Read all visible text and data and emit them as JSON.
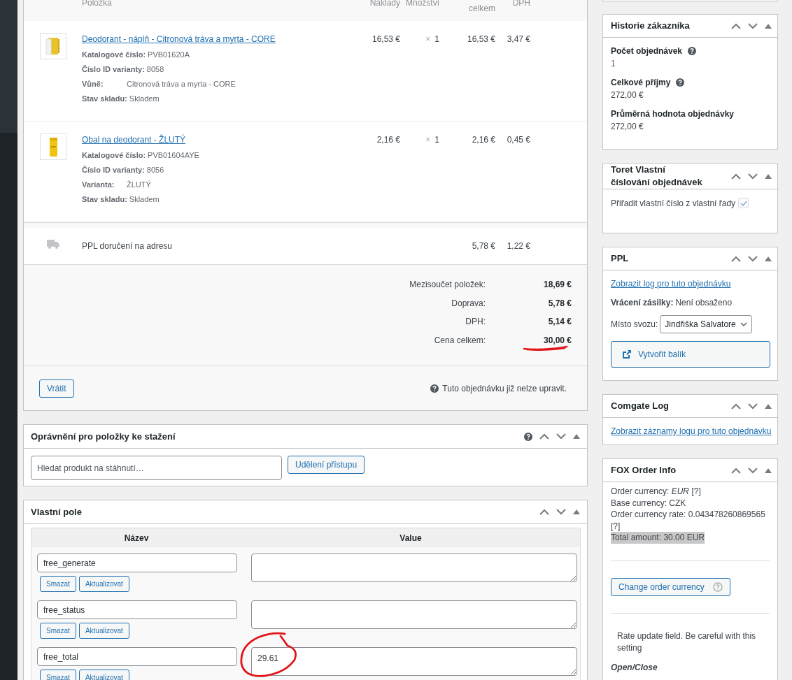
{
  "items_table": {
    "columns": [
      {
        "label": "Položka",
        "kind": "name"
      },
      {
        "label": "Náklady",
        "kind": "num"
      },
      {
        "label": "Množství",
        "kind": "num"
      },
      {
        "label": "celkem",
        "kind": "low"
      },
      {
        "label": "DPH",
        "kind": "num"
      }
    ],
    "items": [
      {
        "name": "Deodorant - náplň - Citronová tráva a myrta - CORE",
        "meta": [
          {
            "kind": "info",
            "label": "Katalogové číslo:",
            "value": "PVB01620A"
          },
          {
            "kind": "info",
            "label": "Číslo ID varianty:",
            "value": "8058"
          },
          {
            "kind": "attribute",
            "label": "Vůně:",
            "value": "Citronová tráva a myrta - CORE"
          },
          {
            "kind": "attribute",
            "label": "Stav skladu:",
            "value": "Skladem"
          }
        ],
        "cost": "16,53 €",
        "quantity_sign": "×",
        "quantity": "1",
        "total": "16,53 €",
        "tax": "3,47 €"
      },
      {
        "name": "Obal na deodorant - ŽLUTÝ",
        "meta": [
          {
            "kind": "info",
            "label": "Katalogové číslo:",
            "value": "PVB01604AYE"
          },
          {
            "kind": "info",
            "label": "Číslo ID varianty:",
            "value": "8056"
          },
          {
            "kind": "attribute",
            "label": "Varianta:",
            "value": "ŽLUTÝ"
          },
          {
            "kind": "attribute",
            "label": "Stav skladu:",
            "value": "Skladem"
          }
        ],
        "cost": "2,16 €",
        "quantity_sign": "×",
        "quantity": "1",
        "total": "2,16 €",
        "tax": "0,45 €"
      }
    ],
    "shipping": {
      "name": "PPL doručení na adresu",
      "total": "5,78 €",
      "tax": "1,22 €"
    },
    "totals": [
      {
        "label": "Mezisoučet položek:",
        "value": "18,69 €"
      },
      {
        "label": "Doprava:",
        "value": "5,78 €"
      },
      {
        "label": "DPH:",
        "value": "5,14 €"
      },
      {
        "label": "Cena celkem:",
        "value": "30,00 €",
        "marked": true
      }
    ],
    "refund_button": "Vrátit",
    "note": "Tuto objednávku již nelze upravit."
  },
  "downloads": {
    "title": "Oprávnění pro položky ke stažení",
    "help": true,
    "search": {
      "placeholder": "Hledat produkt na stáhnutí…"
    },
    "grant_button": "Udělení přístupu"
  },
  "custom_fields": {
    "title": "Vlastní pole",
    "columns": [
      "Název",
      "Value"
    ],
    "rows": [
      {
        "key": "free_generate",
        "delete_button": "Smazat",
        "update_button": "Aktualizovat"
      },
      {
        "key": "free_status",
        "delete_button": "Smazat",
        "update_button": "Aktualizovat"
      },
      {
        "key": "free_total",
        "value": "29.61",
        "circled": true,
        "delete_button": "Smazat",
        "update_button": "Aktualizovat"
      }
    ]
  },
  "sidebar": {
    "customer_history": {
      "title": "Historie zákazníka",
      "stats": [
        {
          "label": "Počet objednávek",
          "help": true,
          "value": "1",
          "link": true
        },
        {
          "label": "Celkové příjmy",
          "help": true,
          "value": "272,00 €",
          "link": false
        },
        {
          "label": "Průměrná hodnota objednávky",
          "help": false,
          "value": "272,00 €",
          "link": false
        }
      ]
    },
    "numbering": {
      "title_lines": [
        "Toret Vlastní",
        "číslování objednávek"
      ],
      "option": {
        "label": "Přiřadit vlastní číslo z vlastní řady",
        "checked": true,
        "disabled": true
      }
    },
    "ppl": {
      "title": "PPL",
      "log_link": "Zobrazit log pro tuto objednávku",
      "return_label": "Vrácení zásilky:",
      "return_value": "Není obsaženo",
      "pickup_label": "Místo svozu:",
      "pickup_value": "Jindřiška Salvatore",
      "create_button": "Vytvořit balík"
    },
    "comgate": {
      "title": "Comgate Log",
      "log_link": "Zobrazit záznamy logu pro tuto objednávku"
    },
    "fox": {
      "title": "FOX Order Info",
      "lines": [
        {
          "text": "Order currency: *EUR*  [?]",
          "highlighted": false
        },
        {
          "text": "Base currency: CZK",
          "highlighted": false
        },
        {
          "text": "Order currency rate: 0.043478260869565",
          "highlighted": false
        },
        {
          "text": "[?]",
          "highlighted": false
        },
        {
          "text": "Total amount: 30.00 EUR",
          "highlighted": true
        }
      ],
      "change_button": "Change order currency",
      "rate_note": "Rate update field. Be careful with this setting",
      "cut_heading": "Open/Close"
    }
  }
}
